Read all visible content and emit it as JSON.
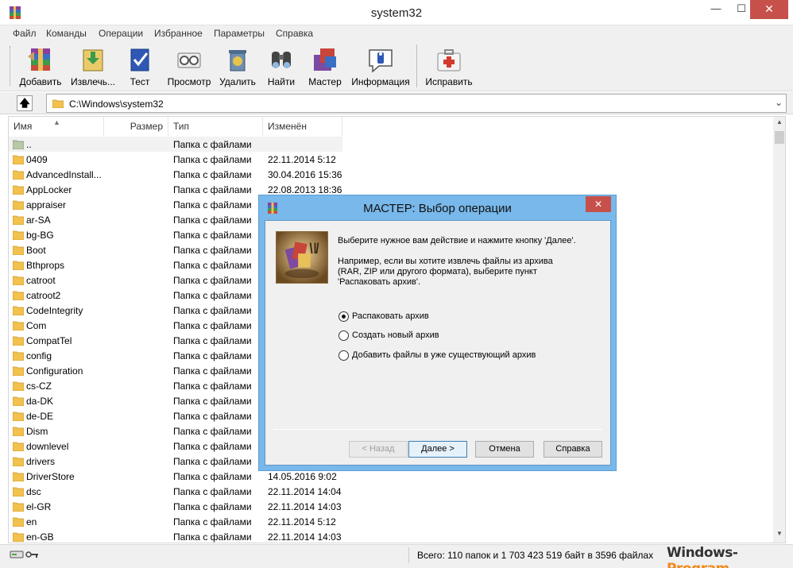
{
  "window": {
    "title": "system32",
    "min_glyph": "—",
    "max_glyph": "☐",
    "close_glyph": "✕"
  },
  "menu": [
    "Файл",
    "Команды",
    "Операции",
    "Избранное",
    "Параметры",
    "Справка"
  ],
  "toolbar": [
    {
      "label": "Добавить",
      "icon": "archive-add-icon"
    },
    {
      "label": "Извлечь...",
      "icon": "extract-icon"
    },
    {
      "label": "Тест",
      "icon": "test-icon"
    },
    {
      "label": "Просмотр",
      "icon": "view-icon"
    },
    {
      "label": "Удалить",
      "icon": "delete-icon"
    },
    {
      "label": "Найти",
      "icon": "find-icon"
    },
    {
      "label": "Мастер",
      "icon": "wizard-icon"
    },
    {
      "label": "Информация",
      "icon": "info-icon"
    },
    {
      "label": "Исправить",
      "icon": "repair-icon"
    }
  ],
  "address": {
    "path": "C:\\Windows\\system32",
    "up_glyph": "🡅",
    "dropdown_glyph": "⌄"
  },
  "columns": {
    "name": "Имя",
    "size": "Размер",
    "type": "Тип",
    "modified": "Изменён",
    "sort_glyph": "▲"
  },
  "rows": [
    {
      "name": "..",
      "type": "Папка с файлами",
      "date": ""
    },
    {
      "name": "0409",
      "type": "Папка с файлами",
      "date": "22.11.2014 5:12"
    },
    {
      "name": "AdvancedInstall...",
      "type": "Папка с файлами",
      "date": "30.04.2016 15:36"
    },
    {
      "name": "AppLocker",
      "type": "Папка с файлами",
      "date": "22.08.2013 18:36"
    },
    {
      "name": "appraiser",
      "type": "Папка с файлами",
      "date": ""
    },
    {
      "name": "ar-SA",
      "type": "Папка с файлами",
      "date": ""
    },
    {
      "name": "bg-BG",
      "type": "Папка с файлами",
      "date": ""
    },
    {
      "name": "Boot",
      "type": "Папка с файлами",
      "date": ""
    },
    {
      "name": "Bthprops",
      "type": "Папка с файлами",
      "date": ""
    },
    {
      "name": "catroot",
      "type": "Папка с файлами",
      "date": ""
    },
    {
      "name": "catroot2",
      "type": "Папка с файлами",
      "date": ""
    },
    {
      "name": "CodeIntegrity",
      "type": "Папка с файлами",
      "date": ""
    },
    {
      "name": "Com",
      "type": "Папка с файлами",
      "date": ""
    },
    {
      "name": "CompatTel",
      "type": "Папка с файлами",
      "date": ""
    },
    {
      "name": "config",
      "type": "Папка с файлами",
      "date": ""
    },
    {
      "name": "Configuration",
      "type": "Папка с файлами",
      "date": ""
    },
    {
      "name": "cs-CZ",
      "type": "Папка с файлами",
      "date": ""
    },
    {
      "name": "da-DK",
      "type": "Папка с файлами",
      "date": ""
    },
    {
      "name": "de-DE",
      "type": "Папка с файлами",
      "date": ""
    },
    {
      "name": "Dism",
      "type": "Папка с файлами",
      "date": ""
    },
    {
      "name": "downlevel",
      "type": "Папка с файлами",
      "date": ""
    },
    {
      "name": "drivers",
      "type": "Папка с файлами",
      "date": ""
    },
    {
      "name": "DriverStore",
      "type": "Папка с файлами",
      "date": "14.05.2016 9:02"
    },
    {
      "name": "dsc",
      "type": "Папка с файлами",
      "date": "22.11.2014 14:04"
    },
    {
      "name": "el-GR",
      "type": "Папка с файлами",
      "date": "22.11.2014 14:03"
    },
    {
      "name": "en",
      "type": "Папка с файлами",
      "date": "22.11.2014 5:12"
    },
    {
      "name": "en-GB",
      "type": "Папка с файлами",
      "date": "22.11.2014 14:03"
    }
  ],
  "status": {
    "text": "Всего: 110 папок и 1 703 423 519 байт в 3596 файлах"
  },
  "watermark": {
    "part1": "Windows-",
    "part2": "Program"
  },
  "dialog": {
    "title": "МАСТЕР:  Выбор операции",
    "close_glyph": "✕",
    "intro": "Выберите нужное вам действие и нажмите кнопку 'Далее'.",
    "example": [
      "Например, если вы хотите извлечь файлы из архива",
      "(RAR, ZIP или другого формата), выберите пункт",
      "'Распаковать архив'."
    ],
    "options": [
      {
        "label": "Распаковать архив",
        "selected": true
      },
      {
        "label": "Создать новый архив",
        "selected": false
      },
      {
        "label": "Добавить файлы в уже существующий архив",
        "selected": false
      }
    ],
    "buttons": {
      "back": "< Назад",
      "next": "Далее >",
      "cancel": "Отмена",
      "help": "Справка"
    }
  },
  "colors": {
    "dialog_frame": "#78b8ea",
    "close": "#c7504a",
    "folder": "#f2c14e"
  }
}
